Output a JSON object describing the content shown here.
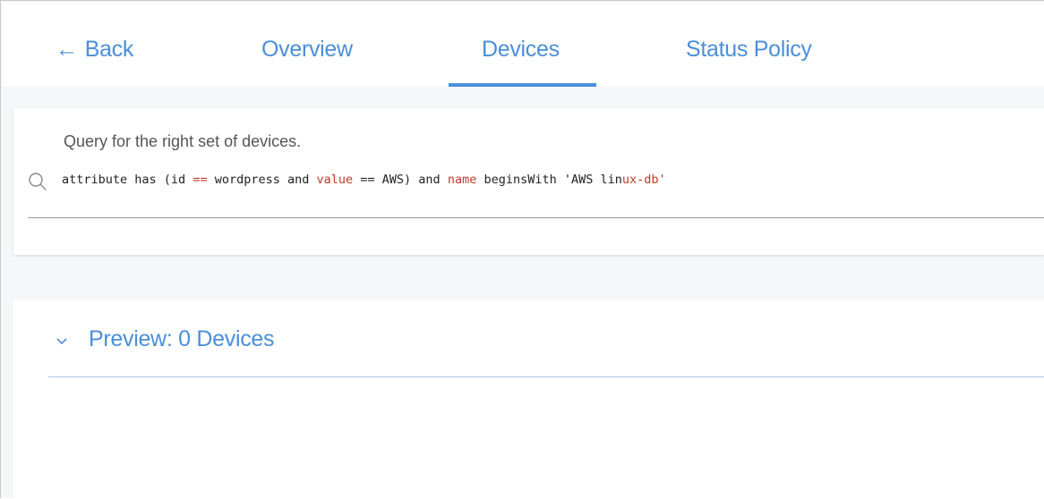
{
  "nav": {
    "back": {
      "arrow": "←",
      "label": "Back",
      "icon": "arrow-left-icon"
    },
    "tabs": [
      {
        "label": "Overview"
      },
      {
        "label": "Devices",
        "active": true
      },
      {
        "label": "Status Policy"
      }
    ]
  },
  "query": {
    "hint": "Query for the right set of devices.",
    "icon": "search-icon",
    "tokens": [
      {
        "text": "attribute has (id ",
        "style": "plain"
      },
      {
        "text": "==",
        "style": "red"
      },
      {
        "text": " wordpress and ",
        "style": "plain"
      },
      {
        "text": "value",
        "style": "red"
      },
      {
        "text": " == AWS) and ",
        "style": "plain"
      },
      {
        "text": "name",
        "style": "red"
      },
      {
        "text": " beginsWith 'AWS lin",
        "style": "plain"
      },
      {
        "text": "ux-db'",
        "style": "red"
      }
    ]
  },
  "preview": {
    "label": "Preview:",
    "count": "0",
    "unit": "Devices",
    "icon": "chevron-down-icon"
  },
  "colors": {
    "accent": "#4a8fd9",
    "keyword_red": "#c0392b",
    "background": "#f6f7f8"
  }
}
